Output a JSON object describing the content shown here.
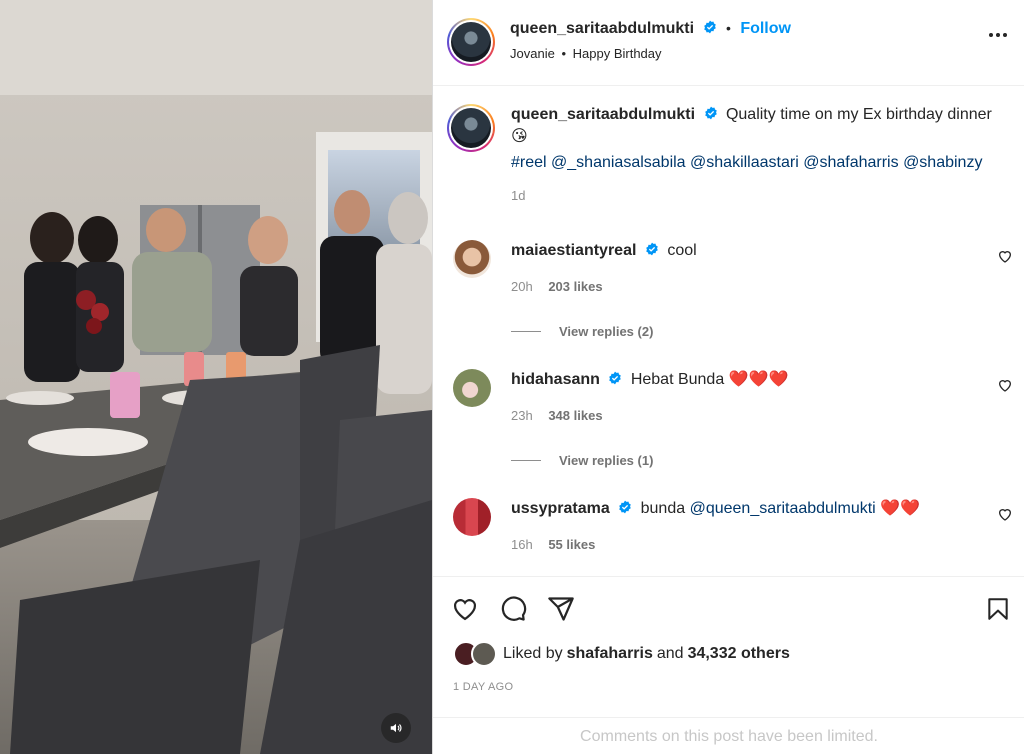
{
  "post": {
    "author": "queen_saritaabdulmukti",
    "follow_label": "Follow",
    "separator": "•",
    "audio_artist": "Jovanie",
    "audio_title": "Happy Birthday",
    "more_icon": "more-horizontal-icon"
  },
  "caption": {
    "author": "queen_saritaabdulmukti",
    "text": "Quality time on my Ex birthday dinner",
    "emoji": "😘",
    "hashtag": "#reel",
    "mentions": [
      "@_shaniasalsabila",
      "@shakillaastari",
      "@shafaharris",
      "@shabinzy"
    ],
    "time": "1d"
  },
  "comments": [
    {
      "user": "maiaestiantyreal",
      "text": "cool",
      "time": "20h",
      "likes": "203 likes",
      "replies": "View replies (2)",
      "avatar_color": "#d9b59a"
    },
    {
      "user": "hidahasann",
      "text": "Hebat Bunda",
      "hearts": "❤️❤️❤️",
      "time": "23h",
      "likes": "348 likes",
      "replies": "View replies (1)",
      "avatar_color": "#6b7a4a"
    },
    {
      "user": "ussypratama",
      "text": "bunda",
      "mention": "@queen_saritaabdulmukti",
      "hearts": "❤️❤️",
      "time": "16h",
      "likes": "55 likes",
      "avatar_color": "#c9414a"
    }
  ],
  "actions": {
    "icons": [
      "heart-icon",
      "comment-icon",
      "share-icon",
      "bookmark-icon"
    ],
    "liked_prefix": "Liked by",
    "liked_user": "shafaharris",
    "liked_and": "and",
    "liked_count": "34,332 others",
    "posted": "1 DAY AGO",
    "limited_notice": "Comments on this post have been limited."
  },
  "colors": {
    "link": "#00376b",
    "follow": "#0095f6",
    "muted": "#8e8e8e",
    "verified": "#0095f6"
  }
}
